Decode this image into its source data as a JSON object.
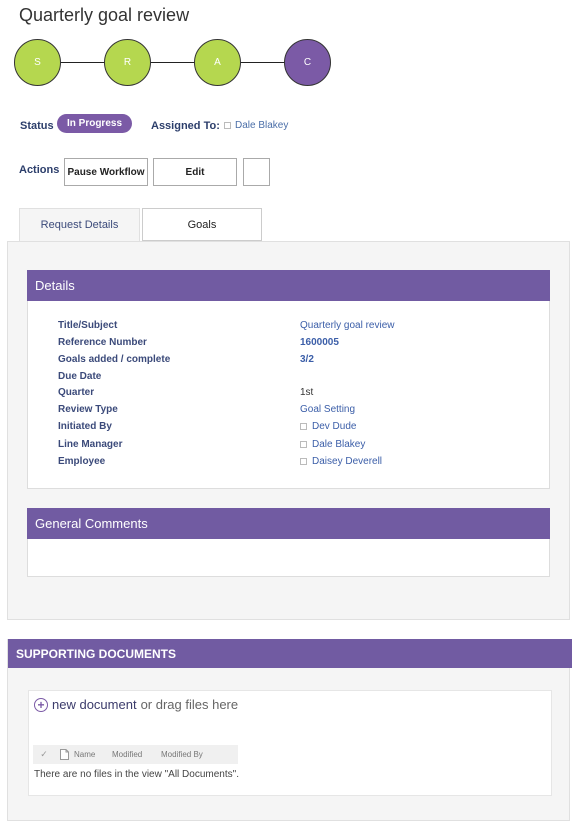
{
  "page": {
    "title": "Quarterly goal review"
  },
  "stages": [
    {
      "label": "S",
      "color": "#b5d74f"
    },
    {
      "label": "R",
      "color": "#b5d74f"
    },
    {
      "label": "A",
      "color": "#b5d74f"
    },
    {
      "label": "C",
      "color": "#7b5aa6"
    }
  ],
  "status": {
    "label": "Status",
    "value": "In Progress"
  },
  "assigned": {
    "label": "Assigned To:",
    "name": "Dale Blakey"
  },
  "actions": {
    "label": "Actions",
    "pause": "Pause Workflow",
    "edit": "Edit"
  },
  "tabs": [
    {
      "label": "Request Details"
    },
    {
      "label": "Goals"
    }
  ],
  "details": {
    "heading": "Details",
    "rows": [
      {
        "label": "Title/Subject",
        "value": "Quarterly goal review"
      },
      {
        "label": "Reference Number",
        "value": "1600005"
      },
      {
        "label": "Goals added / complete",
        "value": "3/2"
      },
      {
        "label": "Due Date",
        "value": ""
      },
      {
        "label": "Quarter",
        "value": "1st"
      },
      {
        "label": "Review Type",
        "value": "Goal Setting"
      },
      {
        "label": "Initiated By",
        "value": "Dev Dude"
      },
      {
        "label": "Line Manager",
        "value": "Dale Blakey"
      },
      {
        "label": "Employee",
        "value": "Daisey Deverell"
      }
    ]
  },
  "comments": {
    "heading": "General Comments"
  },
  "docs": {
    "heading": "SUPPORTING DOCUMENTS",
    "new_link": "new document",
    "drag_text": "or drag files here",
    "columns": {
      "name": "Name",
      "modified": "Modified",
      "modified_by": "Modified By"
    },
    "empty": "There are no files in the view \"All Documents\"."
  },
  "colors": {
    "accent": "#715ba2",
    "stage_done": "#b5d74f",
    "link": "#3b5ea8"
  }
}
